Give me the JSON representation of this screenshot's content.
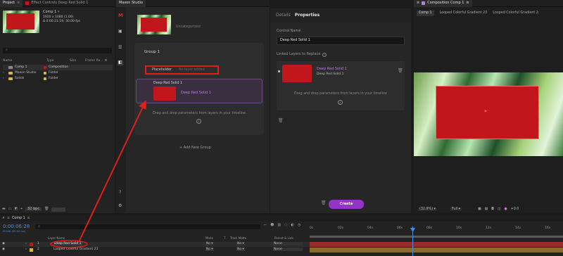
{
  "project": {
    "tab_label": "Project",
    "effect_tab_label": "Effect Controls Deep Red Solid 1",
    "comp_name": "Comp 1",
    "comp_dims": "1920 x 1080 (1.00)",
    "comp_duration": "Δ 0:00:21:19, 30.00 fps",
    "search_placeholder": "",
    "columns": [
      "Name",
      "Type",
      "Size",
      "Frame Ra..."
    ],
    "items": [
      {
        "name": "Comp 1",
        "type": "Composition",
        "icon": "composition-icon"
      },
      {
        "name": "Maxon Studio",
        "type": "Folder",
        "icon": "folder-icon"
      },
      {
        "name": "Solids",
        "type": "Folder",
        "icon": "folder-icon"
      }
    ],
    "bpc": "32 bpc"
  },
  "studio": {
    "tab_label": "Maxon Studio",
    "uncategorized": "Uncategorized",
    "group_title": "Group 1",
    "placeholder_label": "Placeholder",
    "no_layer_added": "No layer added",
    "card_title": "Deep Red Solid 1",
    "card_layer_name": "Deep Red Solid 1",
    "drop_hint": "Drag and drop parameters from layers in your timeline",
    "add_group": "+ Add New Group"
  },
  "properties": {
    "tabs": [
      "Details",
      "Properties"
    ],
    "control_name_label": "Control Name",
    "control_name_value": "Deep Red Solid 1",
    "linked_label": "Linked Layers to Replace",
    "linked_title": "Deep Red Solid 1",
    "linked_sub": "Deep Red Solid 1",
    "drop_hint": "Drag and drop parameters from layers in your timeline",
    "create_label": "Create"
  },
  "viewer": {
    "tab_label": "Composition Comp 1",
    "sub_tabs": [
      "Comp 1",
      "Looped Colorful Gradient 23",
      "Looped Colorful Gradient 2:"
    ],
    "zoom": "(32.9%)",
    "quality": "Full",
    "exposure": "+0.0"
  },
  "timeline": {
    "tab_label": "Comp 1",
    "timecode": "0:00:06:28",
    "frame_info": "00208 (30.00 fps)",
    "search_placeholder": "",
    "header_cols": [
      "Layer Name",
      "Mode",
      "T",
      "Track Matte",
      "Parent & Link"
    ],
    "layers": [
      {
        "num": "1",
        "name": "Deep Red Solid 1",
        "mode": "Nc",
        "matte": "No",
        "parent": "None"
      },
      {
        "num": "2",
        "name": "Looped Colorful Gradient 23",
        "mode": "Nc",
        "matte": "No",
        "parent": "None"
      }
    ],
    "ruler": [
      "0s",
      "02s",
      "04s",
      "06s",
      "08s",
      "10s",
      "12s",
      "14s",
      "16s"
    ]
  },
  "colors": {
    "accent": "#9433c8",
    "annotation": "#e01e1e",
    "layer_red": "#c1171c",
    "playhead": "#3d8ee8"
  }
}
